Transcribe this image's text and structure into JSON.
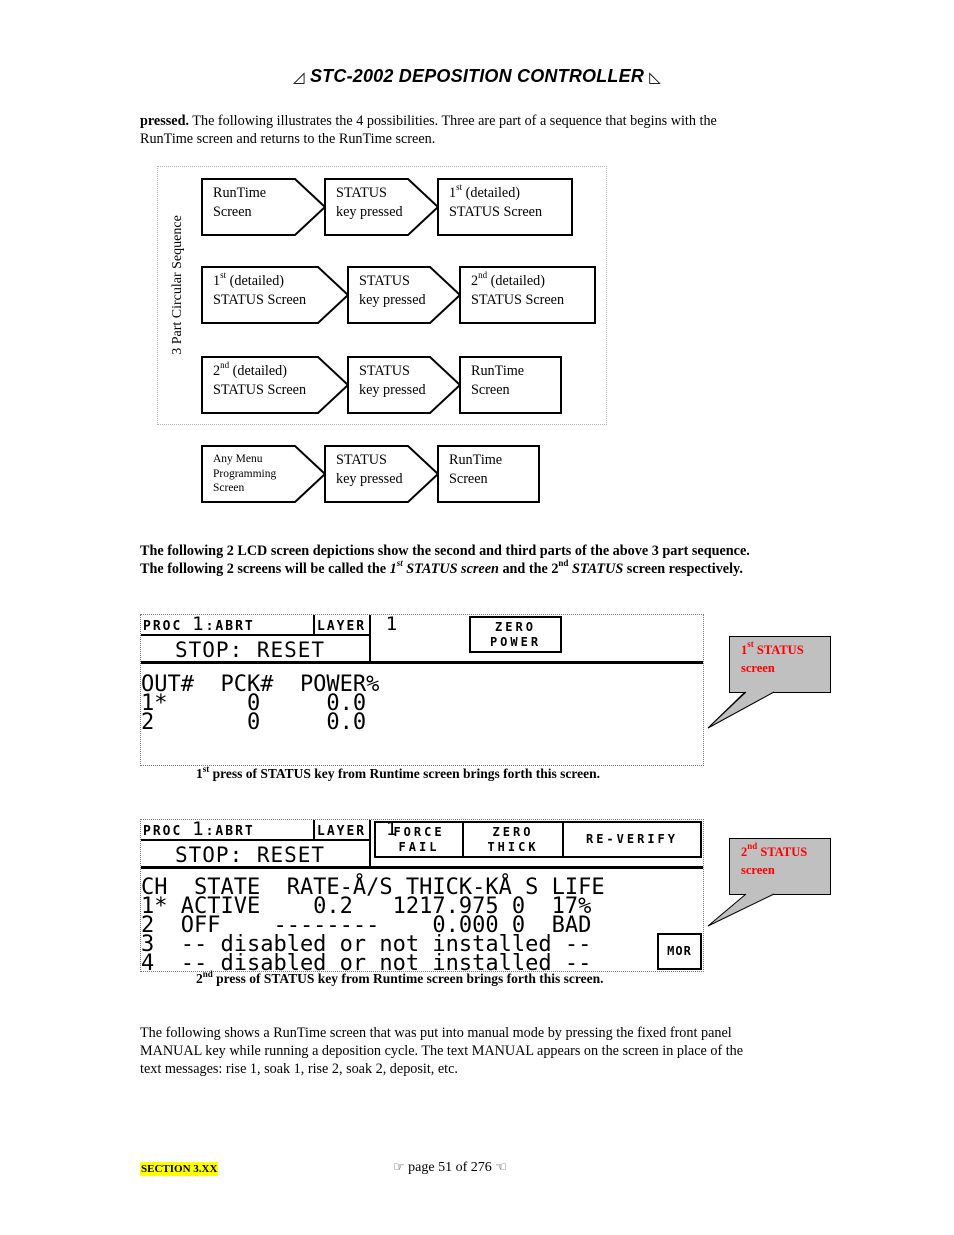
{
  "header": {
    "title": "STC-2002  DEPOSITION CONTROLLER",
    "left_deco_icon": "◿",
    "right_deco_icon": "◺"
  },
  "intro": {
    "lead_bold": "pressed.",
    "line1_rest": " The following illustrates the 4 possibilities. Three are part of a sequence that begins with the",
    "line2": "RunTime screen and returns to the RunTime screen."
  },
  "sequence": {
    "side_label": "3 Part Circular Sequence",
    "rows": [
      [
        {
          "l1": "RunTime",
          "l2": "Screen",
          "shape": "arrow"
        },
        {
          "l1": "STATUS",
          "l2": "key pressed",
          "shape": "arrow"
        },
        {
          "l1_num": "1",
          "l1_sup": "st",
          "l1_rest": " (detailed)",
          "l2": "STATUS Screen",
          "shape": "rect"
        }
      ],
      [
        {
          "l1_num": "1",
          "l1_sup": "st",
          "l1_rest": " (detailed)",
          "l2": "STATUS Screen",
          "shape": "arrow"
        },
        {
          "l1": "STATUS",
          "l2": "key pressed",
          "shape": "arrow"
        },
        {
          "l1_num": "2",
          "l1_sup": "nd",
          "l1_rest": " (detailed)",
          "l2": "STATUS Screen",
          "shape": "rect"
        }
      ],
      [
        {
          "l1_num": "2",
          "l1_sup": "nd",
          "l1_rest": " (detailed)",
          "l2": "STATUS Screen",
          "shape": "arrow"
        },
        {
          "l1": "STATUS",
          "l2": "key pressed",
          "shape": "arrow"
        },
        {
          "l1": "RunTime",
          "l2": "Screen",
          "shape": "rect"
        }
      ]
    ],
    "extra_row": [
      {
        "l1": "Any Menu",
        "l2": "Programming",
        "l3": "Screen",
        "shape": "arrow"
      },
      {
        "l1": "STATUS",
        "l2": "key pressed",
        "shape": "arrow"
      },
      {
        "l1": "RunTime",
        "l2": "Screen",
        "shape": "rect"
      }
    ]
  },
  "lcd_intro": {
    "line1": "The following 2 LCD screen depictions show the second and third parts of the above 3 part sequence.",
    "line2_a": "The following 2 screens will be called the ",
    "line2_num1": "1",
    "line2_sup1": "st",
    "line2_it1": " STATUS screen",
    "line2_b": " and the ",
    "line2_num2": "2",
    "line2_sup2": "nd",
    "line2_it2": " STATUS",
    "line2_c": " screen respectively."
  },
  "lcd1": {
    "proc": "PROC",
    "proc_num": "1",
    "proc_state": "ABRT",
    "layer": "LAYER",
    "layer_num": "1",
    "stop": "STOP: RESET",
    "button_l1": "ZERO",
    "button_l2": "POWER",
    "rows": [
      "OUT#  PCK#  POWER%",
      "1*      0     0.0",
      "2       0     0.0"
    ],
    "caption_num": "1",
    "caption_sup": "st",
    "caption_rest": " press of STATUS key from Runtime screen brings forth this screen.",
    "callout_num": "1",
    "callout_sup": "st",
    "callout_l1": " STATUS",
    "callout_l2": "screen"
  },
  "lcd2": {
    "proc": "PROC",
    "proc_num": "1",
    "proc_state": "ABRT",
    "layer": "LAYER",
    "layer_num": "1",
    "stop": "STOP: RESET",
    "buttons": [
      {
        "l1": "FORCE",
        "l2": "FAIL"
      },
      {
        "l1": "ZERO",
        "l2": "THICK"
      },
      {
        "l1": "RE-VERIFY",
        "l2": ""
      }
    ],
    "rows": [
      "CH  STATE  RATE-Å/S THICK-KÅ S LIFE",
      "1* ACTIVE    0.2   1217.975 0  17%",
      "2  OFF    --------    0.000 0  BAD",
      "3  -- disabled or not installed --",
      "4  -- disabled or not installed --"
    ],
    "more_button": "MOR",
    "caption_num": "2",
    "caption_sup": "nd",
    "caption_rest": " press of STATUS key from Runtime screen brings forth this screen.",
    "callout_num": "2",
    "callout_sup": "nd",
    "callout_l1": " STATUS",
    "callout_l2": "screen"
  },
  "manual_para": {
    "line1": "The following shows a RunTime screen that was put into manual mode by pressing the fixed front panel",
    "line2": "MANUAL key while running a deposition cycle. The text MANUAL appears on the screen in place of the",
    "line3": "text messages: rise 1, soak 1, rise 2, soak 2, deposit, etc."
  },
  "footer": {
    "section": "SECTION 3.XX",
    "page_text": "page 51 of 276",
    "left_hand_icon": "☞",
    "right_hand_icon": "☜",
    "highlight_color": "#ffff00"
  },
  "colors": {
    "callout_fill": "#c0c0c0",
    "callout_text": "#ff0000"
  }
}
